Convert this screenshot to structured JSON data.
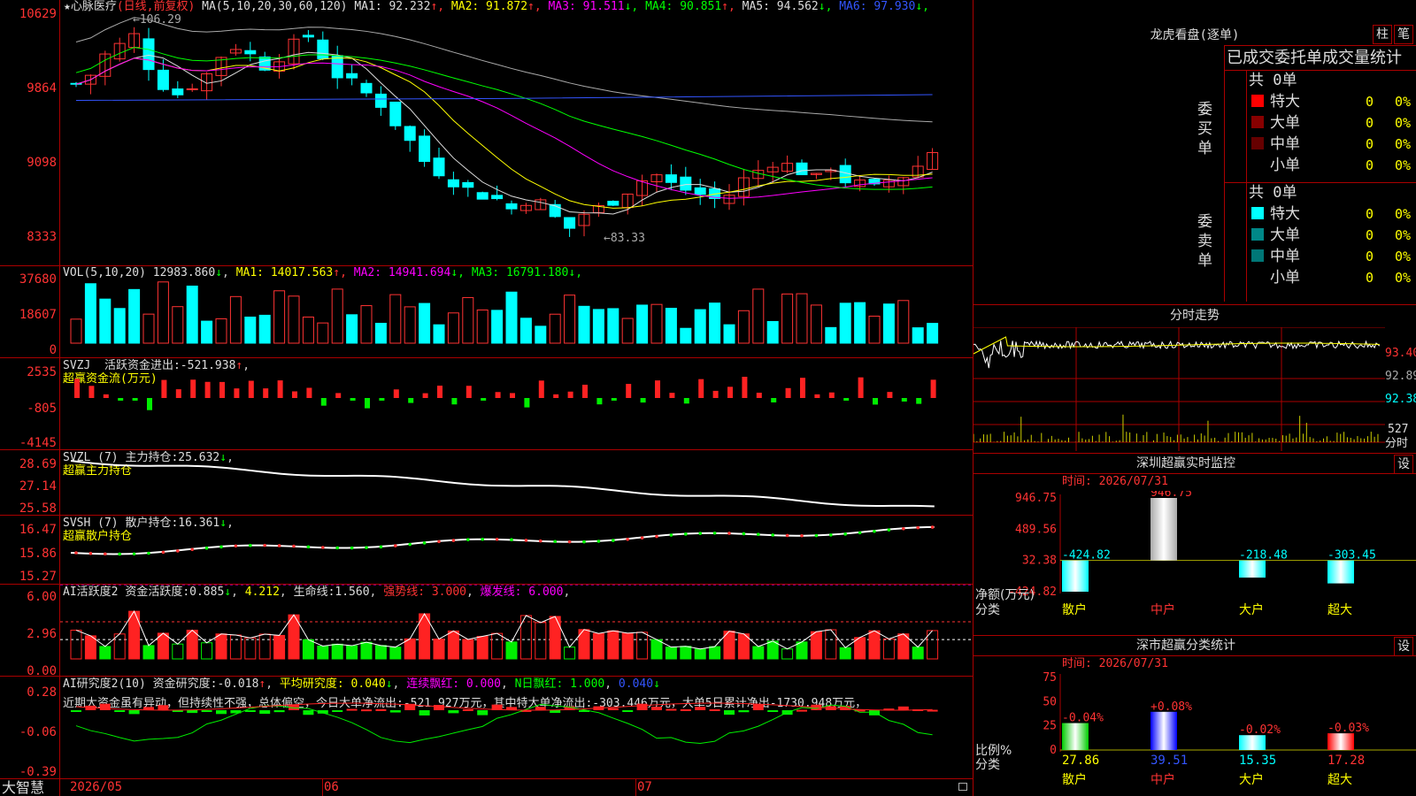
{
  "stock": {
    "name": "★心脉医疗",
    "period": "(日线,前复权)"
  },
  "ma_legend": {
    "label": "MA(5,10,20,30,60,120)",
    "items": [
      {
        "name": "MA1:",
        "value": "92.232",
        "arrow": "↑",
        "color": "#ddd",
        "acolor": "#f33"
      },
      {
        "name": "MA2:",
        "value": "91.872",
        "arrow": "↑",
        "color": "#ff0",
        "acolor": "#f33"
      },
      {
        "name": "MA3:",
        "value": "91.511",
        "arrow": "↓",
        "color": "#f0f",
        "acolor": "#0f0"
      },
      {
        "name": "MA4:",
        "value": "90.851",
        "arrow": "↑",
        "color": "#0f0",
        "acolor": "#f33"
      },
      {
        "name": "MA5:",
        "value": "94.562",
        "arrow": "↓",
        "color": "#ddd",
        "acolor": "#0f0"
      },
      {
        "name": "MA6:",
        "value": "97.930",
        "arrow": "↓",
        "color": "#35f",
        "acolor": "#0f0"
      }
    ]
  },
  "price_axis": [
    "10629",
    "9864",
    "9098",
    "8333"
  ],
  "price_high_label": "106.29",
  "price_low_label": "83.33",
  "vol": {
    "label": "VOL(5,10,20)",
    "value": "12983.860",
    "arrow": "↓",
    "items": [
      {
        "name": "MA1:",
        "value": "14017.563",
        "arrow": "↑",
        "color": "#ff0",
        "acolor": "#f33"
      },
      {
        "name": "MA2:",
        "value": "14941.694",
        "arrow": "↓",
        "color": "#f0f",
        "acolor": "#0f0"
      },
      {
        "name": "MA3:",
        "value": "16791.180",
        "arrow": "↓",
        "color": "#0f0",
        "acolor": "#0f0"
      }
    ],
    "axis": [
      "37680",
      "18607",
      "0"
    ]
  },
  "svzj": {
    "label": "SVZJ",
    "name": "活跃资金进出:",
    "value": "-521.938",
    "arrow": "↑",
    "sub": "超赢资金流(万元)",
    "axis": [
      "2535",
      "-805",
      "-4145"
    ]
  },
  "svzl": {
    "label": "SVZL (7)",
    "name": "主力持仓:",
    "value": "25.632",
    "arrow": "↓",
    "sub": "超赢主力持仓",
    "axis": [
      "28.69",
      "27.14",
      "25.58"
    ]
  },
  "svsh": {
    "label": "SVSH (7)",
    "name": "散户持仓:",
    "value": "16.361",
    "arrow": "↓",
    "sub": "超赢散户持仓",
    "axis": [
      "16.47",
      "15.86",
      "15.27"
    ]
  },
  "ai1": {
    "label": "AI活跃度2",
    "name": "资金活跃度:",
    "value": "0.885",
    "arrow": "↓",
    "v2": "4.212",
    "life_name": "生命线:",
    "life": "1.560",
    "strong": "强势线: 3.000",
    "burst": "爆发线: 6.000",
    "axis": [
      "6.00",
      "2.96",
      "0.00"
    ]
  },
  "ai2": {
    "label": "AI研究度2(10)",
    "name": "资金研究度:",
    "value": "-0.018",
    "arrow": "↑",
    "avg": "平均研究度: 0.040",
    "avg_arrow": "↓",
    "lian": "连续飘红: 0.000",
    "nri": "N日飘红: 1.000",
    "v4": "0.040",
    "v4_arrow": "↓",
    "comment": "近期大资金虽有异动，但持续性不强，总体偏空，今日大单净流出:-521.927万元，其中特大单净流出:-303.446万元，大单5日累计净出-1730.948万元，",
    "axis": [
      "0.28",
      "-0.06",
      "-0.39"
    ]
  },
  "xaxis": {
    "brand": "大智慧",
    "labels": [
      "2026/05",
      "06",
      "07"
    ]
  },
  "lhb": {
    "title": "龙虎看盘(逐单)",
    "btn1": "柱",
    "btn2": "笔",
    "tabs": "已成交委托单成交量统计",
    "buy": {
      "side": "委买单",
      "total": "共 0单",
      "rows": [
        {
          "name": "特大",
          "count": "0",
          "pct": "0%",
          "color": "#f00"
        },
        {
          "name": "大单",
          "count": "0",
          "pct": "0%",
          "color": "#800"
        },
        {
          "name": "中单",
          "count": "0",
          "pct": "0%",
          "color": "#600"
        },
        {
          "name": "小单",
          "count": "0",
          "pct": "0%",
          "color": "#000"
        }
      ]
    },
    "sell": {
      "side": "委卖单",
      "total": "共 0单",
      "rows": [
        {
          "name": "特大",
          "count": "0",
          "pct": "0%",
          "color": "#0ff"
        },
        {
          "name": "大单",
          "count": "0",
          "pct": "0%",
          "color": "#088"
        },
        {
          "name": "中单",
          "count": "0",
          "pct": "0%",
          "color": "#077"
        },
        {
          "name": "小单",
          "count": "0",
          "pct": "0%",
          "color": "#000"
        }
      ]
    }
  },
  "fenshi": {
    "title": "分时走势",
    "axis": [
      "93.40",
      "92.89",
      "92.38"
    ],
    "vol": "527",
    "vol_label": "分时"
  },
  "sz_monitor": {
    "title": "深圳超赢实时监控",
    "btn": "设",
    "time": "时间: 2026/07/31",
    "axis": [
      "946.75",
      "489.56",
      "32.38",
      "-424.82"
    ],
    "ylabel1": "净额(万元)",
    "ylabel2": "分类",
    "bars": [
      {
        "cat": "散户",
        "value": -424.82,
        "label": "-424.82",
        "color": "#0ff",
        "cc": "#fff"
      },
      {
        "cat": "中户",
        "value": 946.75,
        "label": "946.75",
        "color": "#aaa",
        "cc": "#fff"
      },
      {
        "cat": "大户",
        "value": -218.48,
        "label": "-218.48",
        "color": "#0ff",
        "cc": "#fff"
      },
      {
        "cat": "超大",
        "value": -303.45,
        "label": "-303.45",
        "color": "#0ff",
        "cc": "#fff"
      }
    ]
  },
  "sz_stat": {
    "title": "深市超赢分类统计",
    "btn": "设",
    "time": "时间: 2026/07/31",
    "axis": [
      "75",
      "50",
      "25",
      "0"
    ],
    "ylabel1": "比例%",
    "ylabel2": "分类",
    "bars": [
      {
        "cat": "散户",
        "value": 27.86,
        "label": "27.86",
        "chg": "-0.04%",
        "color": "#0c0",
        "cc": "#fff"
      },
      {
        "cat": "中户",
        "value": 39.51,
        "label": "39.51",
        "chg": "+0.08%",
        "color": "#00f",
        "cc": "#fff"
      },
      {
        "cat": "大户",
        "value": 15.35,
        "label": "15.35",
        "chg": "-0.02%",
        "color": "#0ff",
        "cc": "#fff"
      },
      {
        "cat": "超大",
        "value": 17.28,
        "label": "17.28",
        "chg": "-0.03%",
        "color": "#f00",
        "cc": "#fff"
      }
    ]
  }
}
